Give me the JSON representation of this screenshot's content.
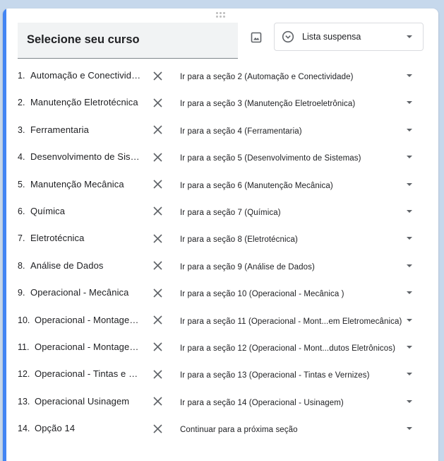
{
  "question": {
    "title": "Selecione seu curso",
    "type_label": "Lista suspensa"
  },
  "options": [
    {
      "num": "1.",
      "label": "Automação e Conectividade",
      "goto": "Ir para a seção 2 (Automação e Conectividade)"
    },
    {
      "num": "2.",
      "label": "Manutenção Eletrotécnica",
      "goto": "Ir para a seção 3 (Manutenção Eletroeletrônica)"
    },
    {
      "num": "3.",
      "label": "Ferramentaria",
      "goto": "Ir para a seção 4 (Ferramentaria)"
    },
    {
      "num": "4.",
      "label": "Desenvolvimento de Sistemas",
      "goto": "Ir para a seção 5 (Desenvolvimento de Sistemas)"
    },
    {
      "num": "5.",
      "label": "Manutenção Mecânica",
      "goto": "Ir para a seção 6 (Manutenção Mecânica)"
    },
    {
      "num": "6.",
      "label": "Química",
      "goto": "Ir para a seção 7 (Química)"
    },
    {
      "num": "7.",
      "label": "Eletrotécnica",
      "goto": "Ir para a seção 8 (Eletrotécnica)"
    },
    {
      "num": "8.",
      "label": "Análise de Dados",
      "goto": "Ir para a seção 9 (Análise de Dados)"
    },
    {
      "num": "9.",
      "label": "Operacional - Mecânica",
      "goto": "Ir para a seção 10 (Operacional - Mecânica )"
    },
    {
      "num": "10.",
      "label": "Operacional - Montagem em Eletromecânica",
      "goto": "Ir para a seção 11 (Operacional - Mont...em Eletromecânica)"
    },
    {
      "num": "11.",
      "label": "Operacional - Montagem de Produtos Eletrônicos",
      "goto": "Ir para a seção 12 (Operacional - Mont...dutos Eletrônicos)"
    },
    {
      "num": "12.",
      "label": "Operacional - Tintas e Vernizes",
      "goto": "Ir para a seção 13 (Operacional - Tintas e Vernizes)"
    },
    {
      "num": "13.",
      "label": "Operacional Usinagem",
      "goto": "Ir para a seção 14 (Operacional - Usinagem)"
    },
    {
      "num": "14.",
      "label": "Opção 14",
      "goto": "Continuar para a próxima seção"
    }
  ],
  "icons": {
    "image": "image-icon",
    "type": "dropdown-circle-icon",
    "remove": "close-icon",
    "arrow": "caret-down-icon"
  },
  "colors": {
    "accent": "#4285f4",
    "background": "#c6d8ec",
    "title_field": "#f1f3f4"
  }
}
